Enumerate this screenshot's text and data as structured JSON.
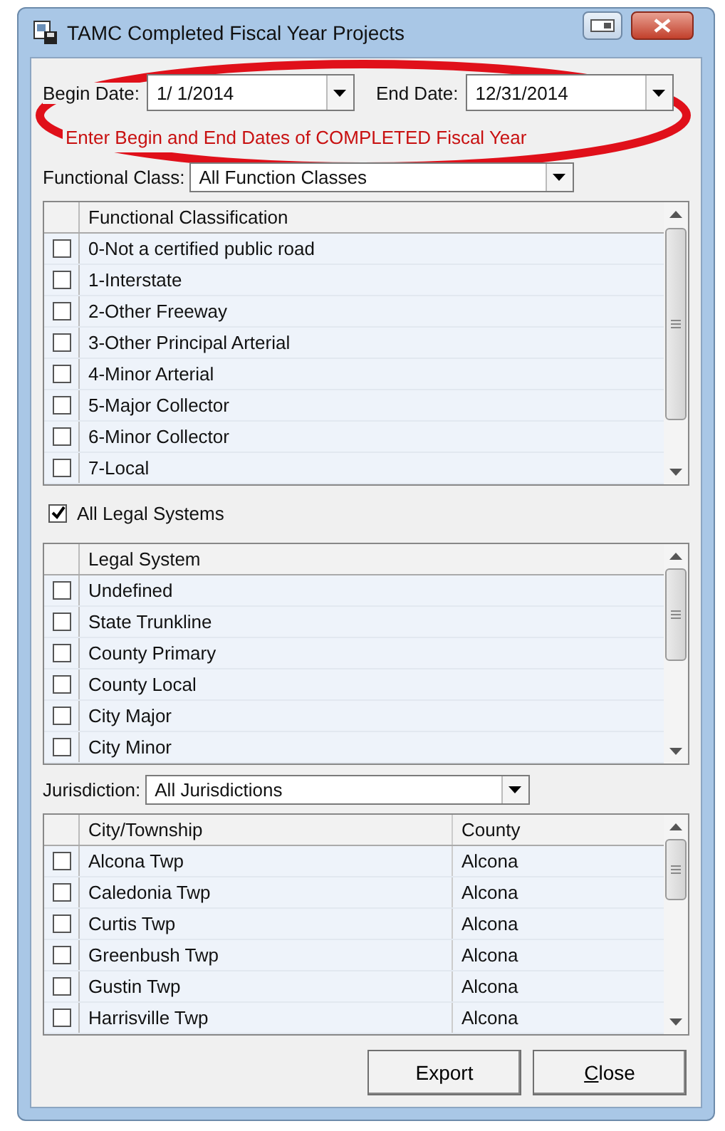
{
  "window": {
    "title": "TAMC Completed Fiscal Year Projects"
  },
  "begin_date": {
    "label": "Begin Date:",
    "value": "1/ 1/2014"
  },
  "end_date": {
    "label": "End Date:",
    "value": "12/31/2014"
  },
  "hint": "Enter Begin and End Dates of COMPLETED Fiscal Year",
  "functional_class": {
    "label": "Functional Class:",
    "value": "All Function Classes"
  },
  "functional_grid": {
    "columns": [
      "Functional Classification"
    ],
    "rows": [
      {
        "cells": [
          "0-Not a certified public road"
        ],
        "checked": false
      },
      {
        "cells": [
          "1-Interstate"
        ],
        "checked": false
      },
      {
        "cells": [
          "2-Other Freeway"
        ],
        "checked": false
      },
      {
        "cells": [
          "3-Other Principal Arterial"
        ],
        "checked": false
      },
      {
        "cells": [
          "4-Minor Arterial"
        ],
        "checked": false
      },
      {
        "cells": [
          "5-Major Collector"
        ],
        "checked": false
      },
      {
        "cells": [
          "6-Minor Collector"
        ],
        "checked": false
      },
      {
        "cells": [
          "7-Local"
        ],
        "checked": false
      }
    ]
  },
  "all_legal_systems": {
    "label": "All Legal Systems",
    "checked": true
  },
  "legal_grid": {
    "columns": [
      "Legal System"
    ],
    "rows": [
      {
        "cells": [
          "Undefined"
        ],
        "checked": false
      },
      {
        "cells": [
          "State Trunkline"
        ],
        "checked": false
      },
      {
        "cells": [
          "County Primary"
        ],
        "checked": false
      },
      {
        "cells": [
          "County Local"
        ],
        "checked": false
      },
      {
        "cells": [
          "City Major"
        ],
        "checked": false
      },
      {
        "cells": [
          "City Minor"
        ],
        "checked": false
      }
    ]
  },
  "jurisdiction": {
    "label": "Jurisdiction:",
    "value": "All Jurisdictions"
  },
  "jurisdiction_grid": {
    "columns": [
      "City/Township",
      "County"
    ],
    "rows": [
      {
        "cells": [
          "Alcona Twp",
          "Alcona"
        ],
        "checked": false
      },
      {
        "cells": [
          "Caledonia Twp",
          "Alcona"
        ],
        "checked": false
      },
      {
        "cells": [
          "Curtis Twp",
          "Alcona"
        ],
        "checked": false
      },
      {
        "cells": [
          "Greenbush Twp",
          "Alcona"
        ],
        "checked": false
      },
      {
        "cells": [
          "Gustin Twp",
          "Alcona"
        ],
        "checked": false
      },
      {
        "cells": [
          "Harrisville Twp",
          "Alcona"
        ],
        "checked": false
      }
    ]
  },
  "buttons": [
    {
      "label": "Export",
      "mnemonic": false
    },
    {
      "label": "Close",
      "mnemonic": true
    }
  ]
}
